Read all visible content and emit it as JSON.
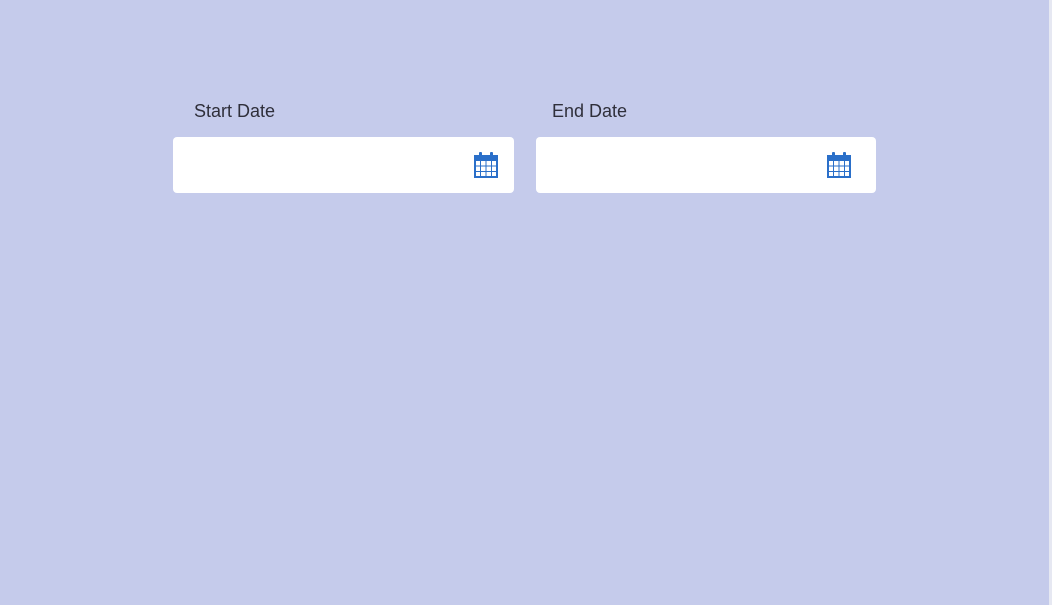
{
  "start_date": {
    "label": "Start Date",
    "value": "",
    "placeholder": "",
    "icon": "calendar-icon"
  },
  "end_date": {
    "label": "End Date",
    "value": "",
    "placeholder": "",
    "icon": "calendar-icon"
  },
  "colors": {
    "background": "#c5cbeb",
    "field_background": "#ffffff",
    "icon": "#2a6fc9",
    "label_text": "#2f2f3a"
  }
}
